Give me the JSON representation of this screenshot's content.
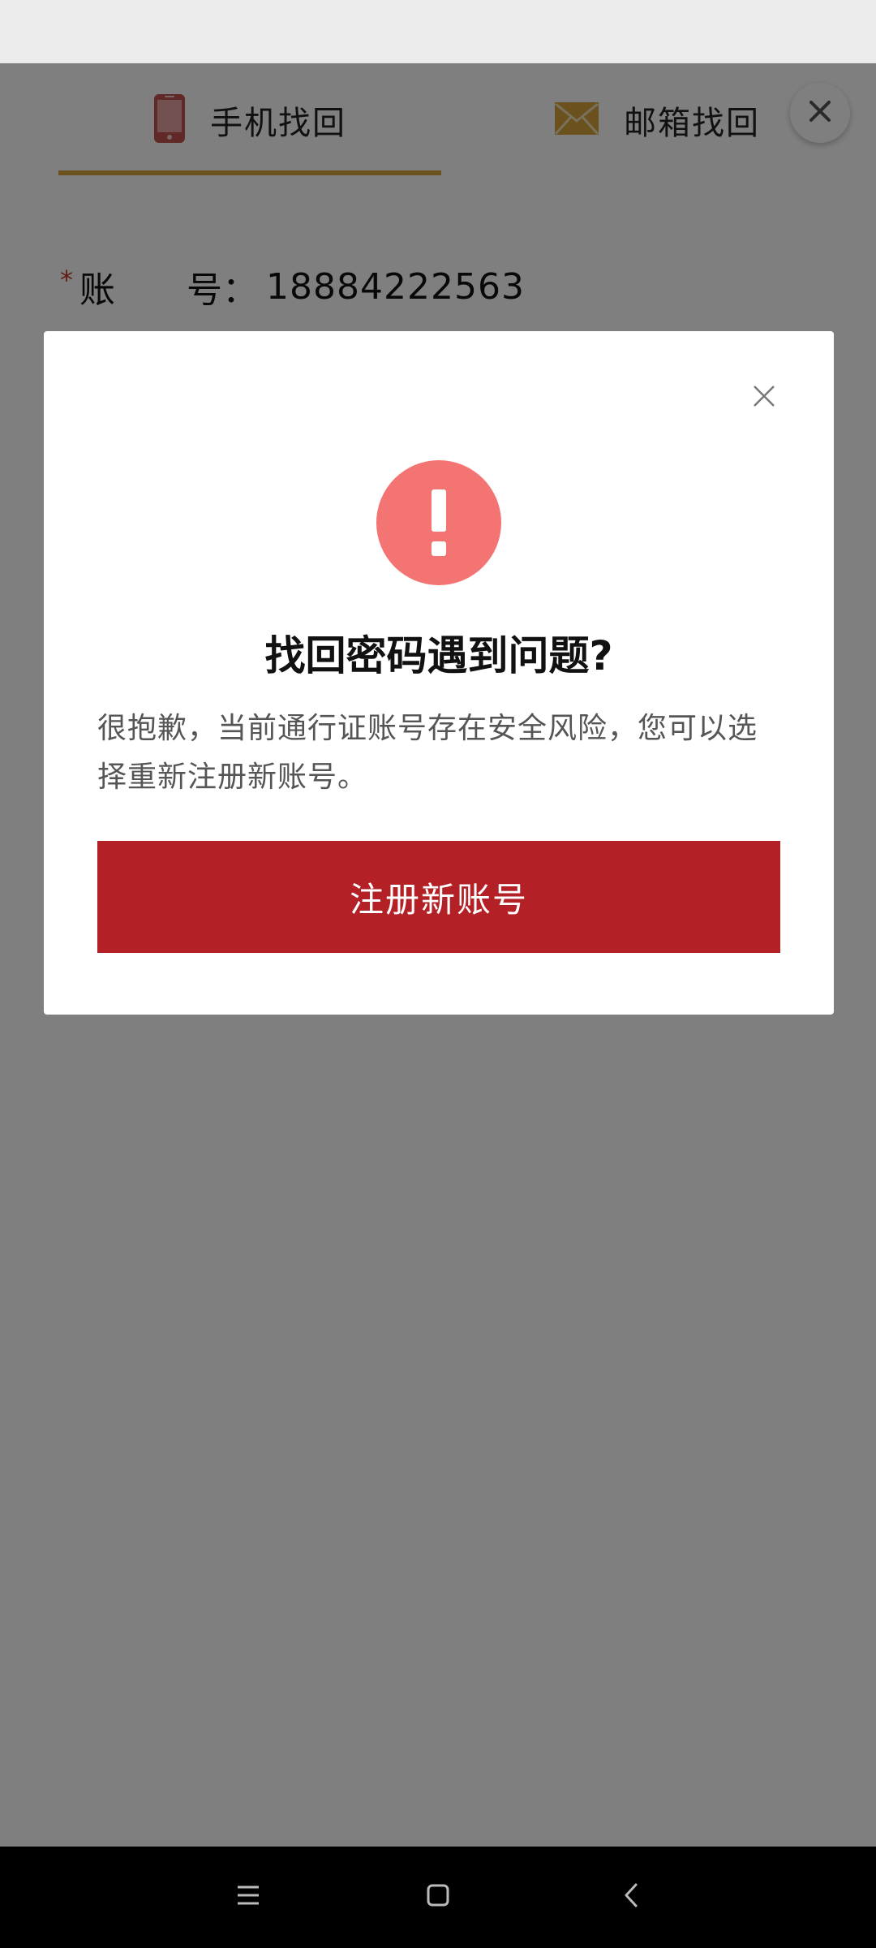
{
  "tabs": [
    {
      "label": "手机找回",
      "icon": "phone-icon",
      "active": true
    },
    {
      "label": "邮箱找回",
      "icon": "mail-icon",
      "active": false
    }
  ],
  "account": {
    "required_mark": "*",
    "label": "账　　号：",
    "value": "18884222563"
  },
  "dialog": {
    "icon": "alert-icon",
    "title": "找回密码遇到问题?",
    "message": "很抱歉，当前通行证账号存在安全风险，您可以选择重新注册新账号。",
    "button_label": "注册新账号"
  },
  "colors": {
    "accent": "#d4a23a",
    "danger": "#b32126",
    "alert": "#f47373",
    "phone_icon": "#c0504d"
  },
  "nav": {
    "icons": [
      "menu-icon",
      "home-icon",
      "back-icon"
    ]
  }
}
